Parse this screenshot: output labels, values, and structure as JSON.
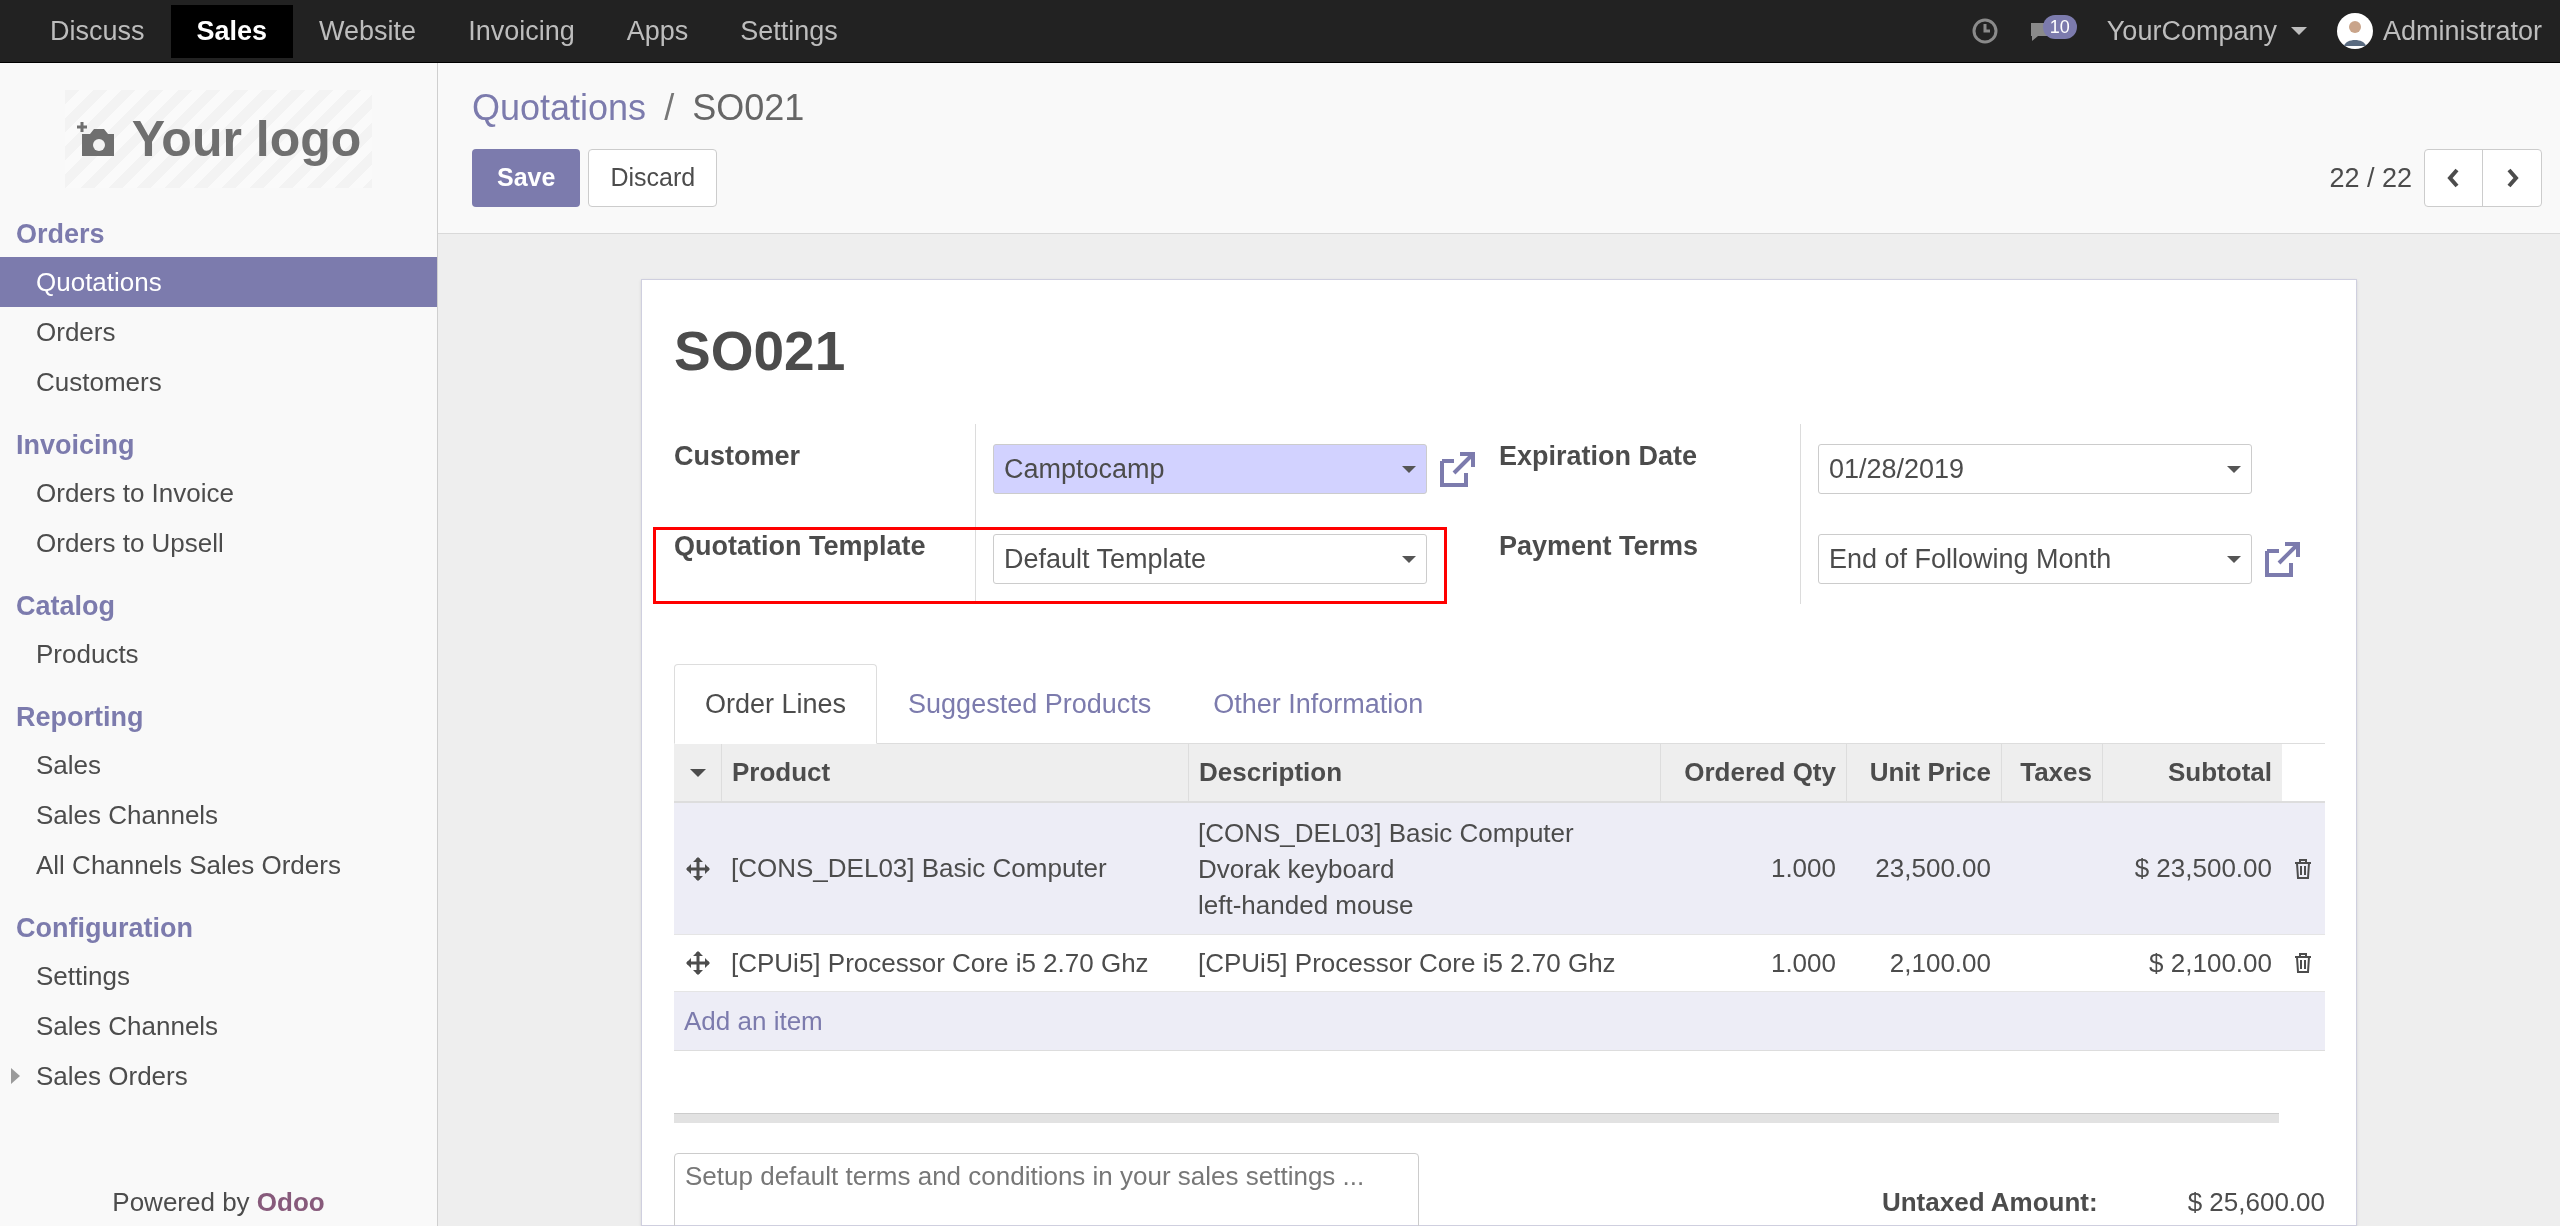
{
  "top_menu": [
    {
      "label": "Discuss",
      "selected": false
    },
    {
      "label": "Sales",
      "selected": true
    },
    {
      "label": "Website",
      "selected": false
    },
    {
      "label": "Invoicing",
      "selected": false
    },
    {
      "label": "Apps",
      "selected": false
    },
    {
      "label": "Settings",
      "selected": false
    }
  ],
  "systray": {
    "notification_count": "10",
    "company": "YourCompany",
    "user": "Administrator"
  },
  "sidebar": {
    "logo_text": "Your logo",
    "sections": [
      {
        "title": "Orders",
        "items": [
          {
            "label": "Quotations",
            "selected": true,
            "has_children": false
          },
          {
            "label": "Orders",
            "selected": false,
            "has_children": false
          },
          {
            "label": "Customers",
            "selected": false,
            "has_children": false
          }
        ]
      },
      {
        "title": "Invoicing",
        "items": [
          {
            "label": "Orders to Invoice",
            "selected": false,
            "has_children": false
          },
          {
            "label": "Orders to Upsell",
            "selected": false,
            "has_children": false
          }
        ]
      },
      {
        "title": "Catalog",
        "items": [
          {
            "label": "Products",
            "selected": false,
            "has_children": false
          }
        ]
      },
      {
        "title": "Reporting",
        "items": [
          {
            "label": "Sales",
            "selected": false,
            "has_children": false
          },
          {
            "label": "Sales Channels",
            "selected": false,
            "has_children": false
          },
          {
            "label": "All Channels Sales Orders",
            "selected": false,
            "has_children": false
          }
        ]
      },
      {
        "title": "Configuration",
        "items": [
          {
            "label": "Settings",
            "selected": false,
            "has_children": false
          },
          {
            "label": "Sales Channels",
            "selected": false,
            "has_children": false
          },
          {
            "label": "Sales Orders",
            "selected": false,
            "has_children": true
          }
        ]
      }
    ],
    "footer_prefix": "Powered by",
    "footer_brand": "Odoo"
  },
  "breadcrumb": [
    "Quotations",
    "SO021"
  ],
  "breadcrumb_separator": "/",
  "buttons": {
    "save": "Save",
    "discard": "Discard"
  },
  "pager": "22 / 22",
  "form": {
    "title": "SO021",
    "left_fields": [
      {
        "label": "Customer",
        "value": "Camptocamp",
        "required": true,
        "external_link": true,
        "highlighted": false
      },
      {
        "label": "Quotation Template",
        "value": "Default Template",
        "required": false,
        "external_link": false,
        "highlighted": true
      }
    ],
    "right_fields": [
      {
        "label": "Expiration Date",
        "value": "01/28/2019",
        "required": false,
        "external_link": false,
        "highlighted": false
      },
      {
        "label": "Payment Terms",
        "value": "End of Following Month",
        "required": false,
        "external_link": true,
        "highlighted": false
      }
    ],
    "tabs": [
      {
        "label": "Order Lines",
        "selected": true
      },
      {
        "label": "Suggested Products",
        "selected": false
      },
      {
        "label": "Other Information",
        "selected": false
      }
    ],
    "table": {
      "columns": [
        "Product",
        "Description",
        "Ordered Qty",
        "Unit Price",
        "Taxes",
        "Subtotal"
      ],
      "rows": [
        {
          "product": "[CONS_DEL03] Basic Computer",
          "description": [
            "[CONS_DEL03] Basic Computer",
            "Dvorak keyboard",
            "left-handed mouse"
          ],
          "ordered_qty": "1.000",
          "unit_price": "23,500.00",
          "subtotal": "$ 23,500.00",
          "selected": true
        },
        {
          "product": "[CPUi5] Processor Core i5 2.70 Ghz",
          "description": [
            "[CPUi5] Processor Core i5 2.70 Ghz"
          ],
          "ordered_qty": "1.000",
          "unit_price": "2,100.00",
          "subtotal": "$ 2,100.00",
          "selected": false
        }
      ],
      "add_item": "Add an item"
    },
    "terms": {
      "placeholder": "Setup default terms and conditions in your sales settings ..."
    },
    "totals": [
      {
        "label": "Untaxed Amount:",
        "value": "$ 25,600.00"
      }
    ]
  }
}
